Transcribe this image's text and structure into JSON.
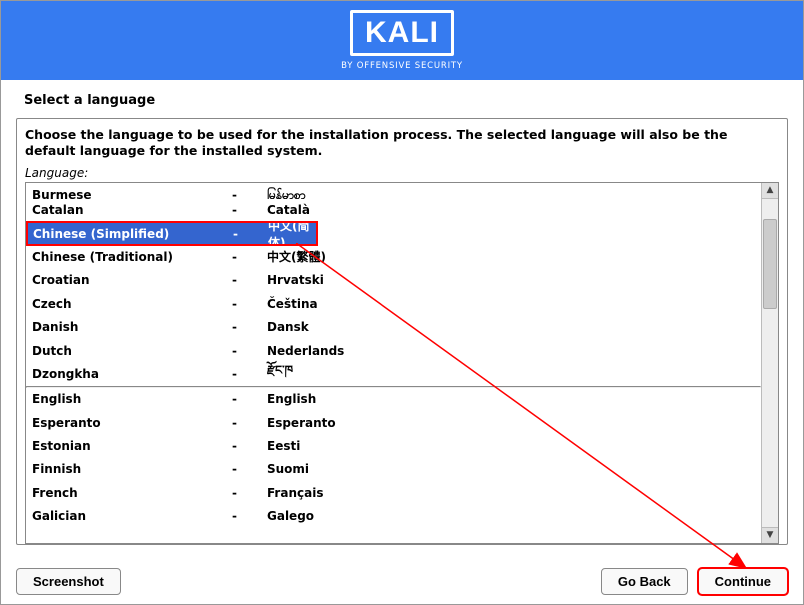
{
  "logo": "KALI",
  "tagline": "BY OFFENSIVE SECURITY",
  "page_title": "Select a language",
  "instruction": "Choose the language to be used for the installation process. The selected language will also be the default language for the installed system.",
  "label": "Language:",
  "languages": [
    {
      "english": "Burmese",
      "dash": "-",
      "native": "မြန်မာစာ",
      "cut": true
    },
    {
      "english": "Catalan",
      "dash": "-",
      "native": "Català"
    },
    {
      "english": "Chinese (Simplified)",
      "dash": "-",
      "native": "中文(简体)",
      "selected": true
    },
    {
      "english": "Chinese (Traditional)",
      "dash": "-",
      "native": "中文(繁體)"
    },
    {
      "english": "Croatian",
      "dash": "-",
      "native": "Hrvatski"
    },
    {
      "english": "Czech",
      "dash": "-",
      "native": "Čeština"
    },
    {
      "english": "Danish",
      "dash": "-",
      "native": "Dansk"
    },
    {
      "english": "Dutch",
      "dash": "-",
      "native": "Nederlands"
    },
    {
      "english": "Dzongkha",
      "dash": "-",
      "native": "རྫོང་ཁ"
    },
    {
      "separator": true
    },
    {
      "english": "English",
      "dash": "-",
      "native": "English"
    },
    {
      "english": "Esperanto",
      "dash": "-",
      "native": "Esperanto"
    },
    {
      "english": "Estonian",
      "dash": "-",
      "native": "Eesti"
    },
    {
      "english": "Finnish",
      "dash": "-",
      "native": "Suomi"
    },
    {
      "english": "French",
      "dash": "-",
      "native": "Français"
    },
    {
      "english": "Galician",
      "dash": "-",
      "native": "Galego"
    }
  ],
  "buttons": {
    "screenshot": "Screenshot",
    "go_back": "Go Back",
    "continue": "Continue"
  }
}
